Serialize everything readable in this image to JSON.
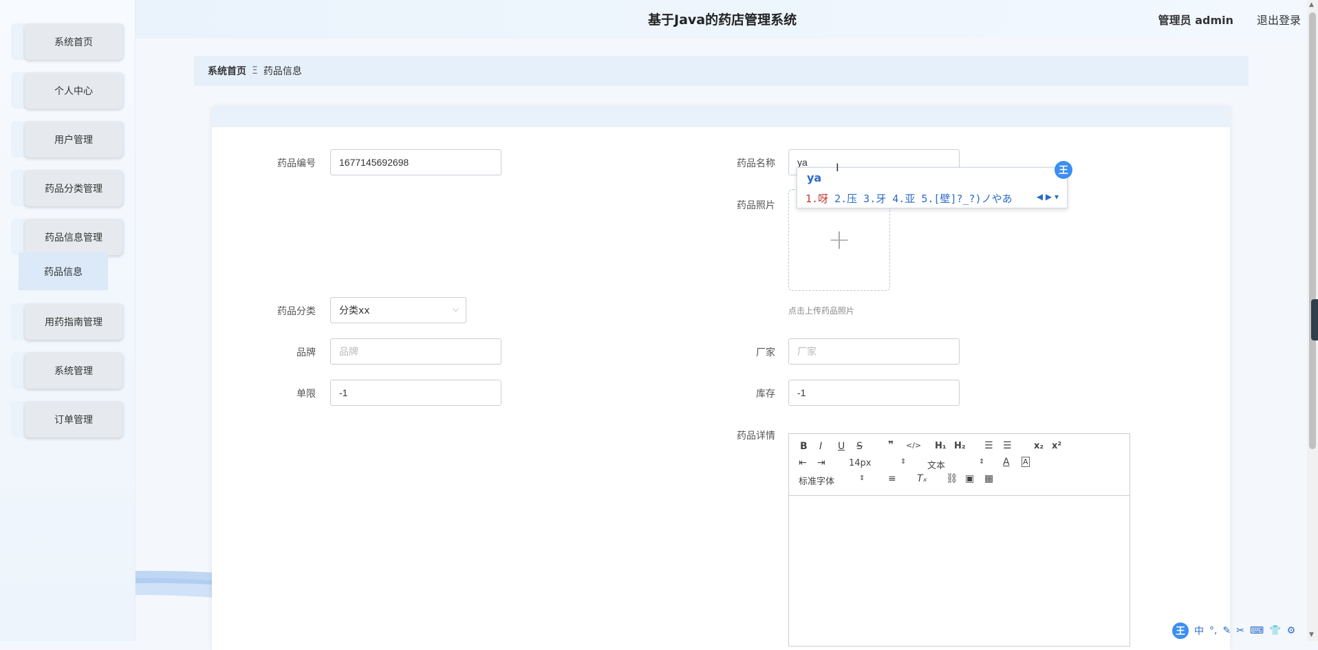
{
  "header": {
    "title": "基于Java的药店管理系统",
    "admin": "管理员 admin",
    "logout": "退出登录"
  },
  "sidebar": {
    "items": [
      {
        "label": "系统首页"
      },
      {
        "label": "个人中心"
      },
      {
        "label": "用户管理"
      },
      {
        "label": "药品分类管理"
      },
      {
        "label": "药品信息管理"
      },
      {
        "label": "用药指南管理"
      },
      {
        "label": "系统管理"
      },
      {
        "label": "订单管理"
      }
    ],
    "submenu": "药品信息"
  },
  "breadcrumb": {
    "home": "系统首页",
    "separator": "Ξ",
    "current": "药品信息"
  },
  "form": {
    "code": {
      "label": "药品编号",
      "value": "1677145692698"
    },
    "name": {
      "label": "药品名称",
      "value": "ya"
    },
    "photo": {
      "label": "药品照片",
      "tip": "点击上传药品照片"
    },
    "category": {
      "label": "药品分类",
      "value": "分类xx"
    },
    "brand": {
      "label": "品牌",
      "placeholder": "品牌"
    },
    "maker": {
      "label": "厂家",
      "placeholder": "厂家"
    },
    "limit": {
      "label": "单限",
      "value": "-1"
    },
    "stock": {
      "label": "库存",
      "value": "-1"
    },
    "detail": {
      "label": "药品详情",
      "font_size": "14px",
      "text_type": "文本",
      "font_family": "标准字体"
    }
  },
  "ime": {
    "pinyin": "ya",
    "candidate_first": "1.呀",
    "candidates_rest": " 2.压 3.牙 4.亚 5.[壁]?_?)ノやあ",
    "logo": "王"
  },
  "ime_status": {
    "logo": "王",
    "mode": "中"
  },
  "colors": {
    "accent": "#3c8ef0",
    "panel_head": "#e9f1fb",
    "breadcrumb_bg": "#e6f0fb"
  }
}
